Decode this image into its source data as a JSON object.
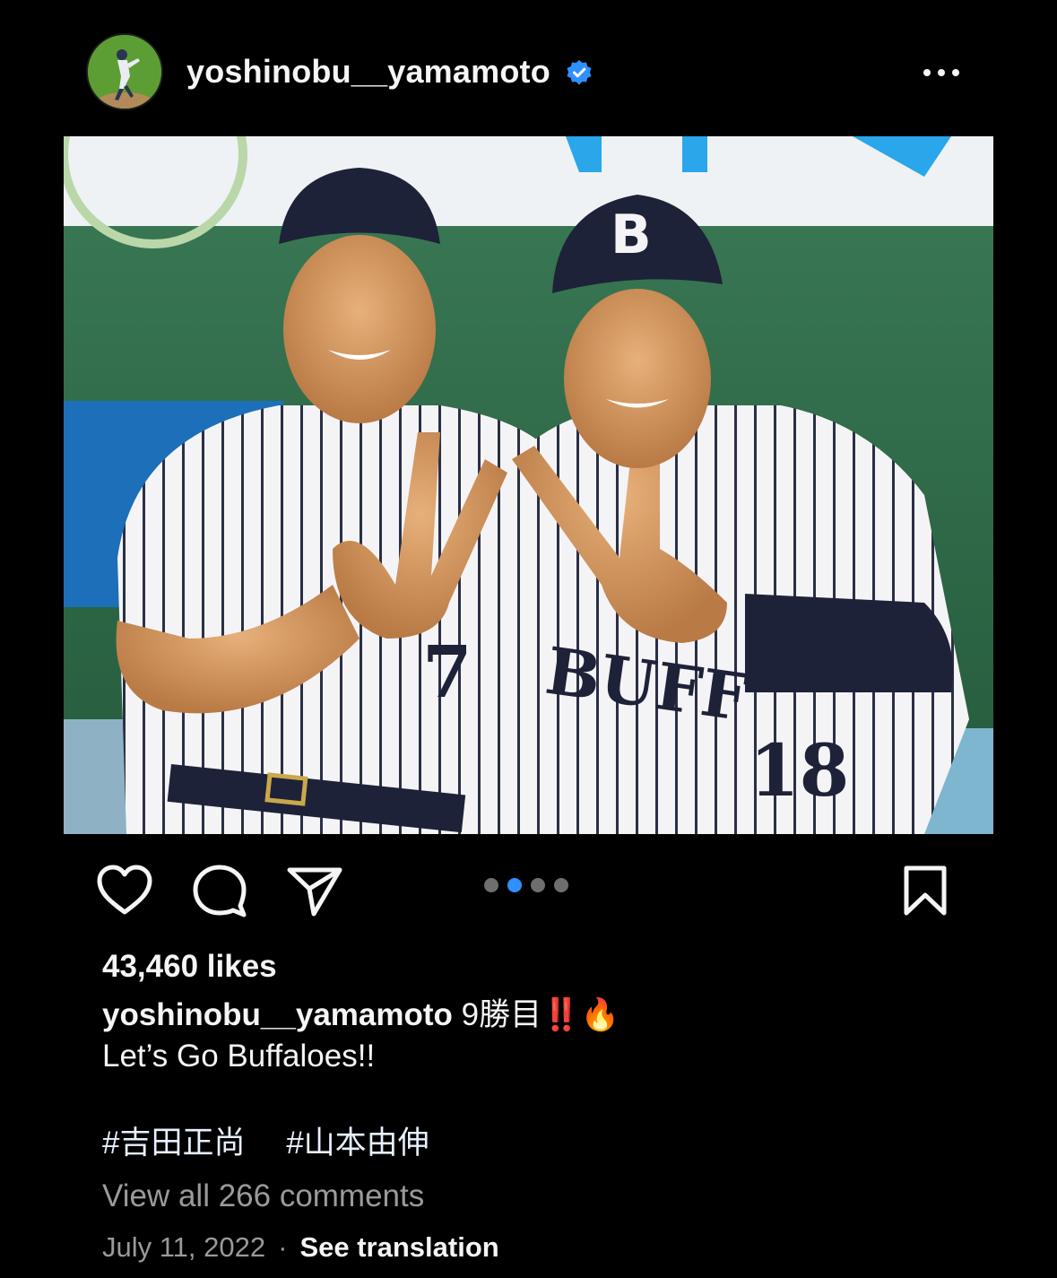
{
  "post": {
    "username": "yoshinobu__yamamoto",
    "verified": true,
    "avatar_alt": "avatar",
    "image_alt": "Two baseball players in pinstripe Buffaloes uniforms making a W hand sign",
    "carousel": {
      "count": 4,
      "active_index": 1
    }
  },
  "actions": {
    "like_icon": "heart-icon",
    "comment_icon": "comment-bubble-icon",
    "share_icon": "paper-plane-icon",
    "save_icon": "bookmark-icon",
    "more_icon": "more-horizontal-icon"
  },
  "engagement": {
    "likes": "43,460 likes"
  },
  "caption": {
    "username": "yoshinobu__yamamoto",
    "text_line1": " 9勝目‼️🔥",
    "text_line2": "Let’s Go Buffaloes!!",
    "hashtags": [
      "#吉田正尚",
      "#山本由伸"
    ]
  },
  "comments": {
    "view_all": "View all 266 comments"
  },
  "footer": {
    "date": "July 11, 2022",
    "separator": "·",
    "translate": "See translation"
  },
  "colors": {
    "background": "#000000",
    "text": "#f5f5f5",
    "muted": "#9a9a9a",
    "accent": "#2f90ff"
  }
}
